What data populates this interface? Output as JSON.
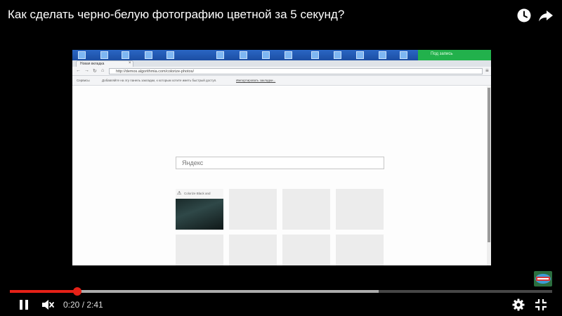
{
  "video": {
    "title": "Как сделать черно-белую фотографию цветной за 5 секунд?",
    "icons": {
      "watch_later": "clock-icon",
      "share": "share-arrow-icon"
    }
  },
  "recording": {
    "taskbar_button": "Под запись",
    "tab_label": "Новая вкладка",
    "url": "http://demos.algorithmia.com/colorize-photos/",
    "bookmarks": {
      "apps": "Сервисы",
      "hint": "Добавляйте на эту панель закладки, к которым хотите иметь быстрый доступ.",
      "import_link": "Импортировать закладки..."
    },
    "search_placeholder": "Яндекс",
    "tile_label": "Colorize Black and"
  },
  "player": {
    "current_time": "0:20",
    "separator": " / ",
    "duration": "2:41",
    "played_fraction": 0.124,
    "buffered_fraction": 0.68,
    "icons": {
      "pause": "pause-icon",
      "mute": "volume-muted-icon",
      "settings": "gear-icon",
      "exit_fullscreen": "exit-fullscreen-icon"
    }
  },
  "colors": {
    "progress_played": "#e52117",
    "background": "#000000"
  }
}
